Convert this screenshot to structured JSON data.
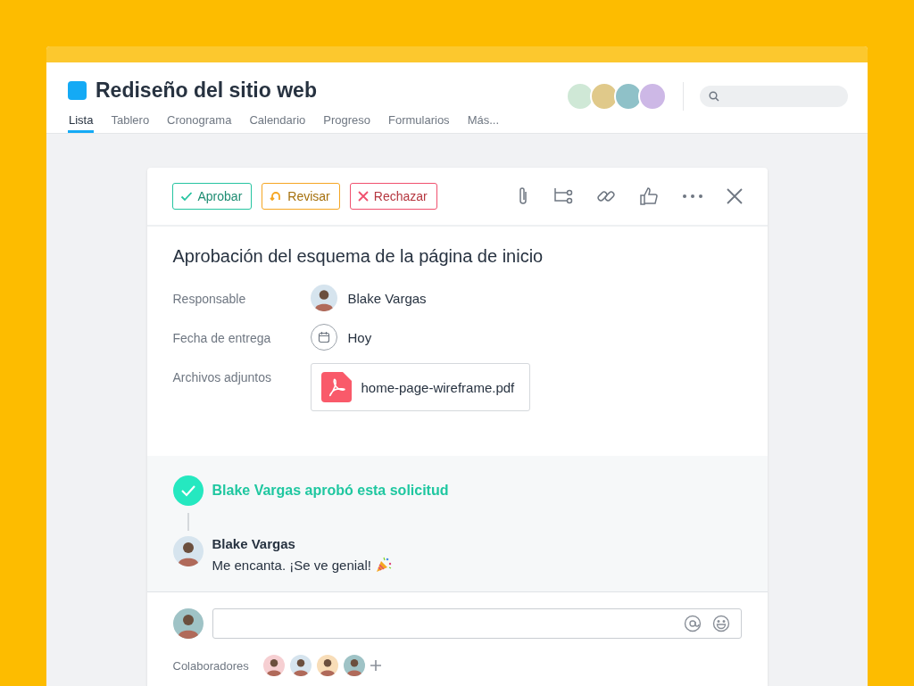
{
  "project": {
    "title": "Rediseño del sitio web"
  },
  "tabs": [
    {
      "label": "Lista",
      "selected": true
    },
    {
      "label": "Tablero",
      "selected": false
    },
    {
      "label": "Cronograma",
      "selected": false
    },
    {
      "label": "Calendario",
      "selected": false
    },
    {
      "label": "Progreso",
      "selected": false
    },
    {
      "label": "Formularios",
      "selected": false
    },
    {
      "label": "Más...",
      "selected": false
    }
  ],
  "task": {
    "actions": [
      {
        "kind": "approve",
        "label": "Aprobar"
      },
      {
        "kind": "revise",
        "label": "Revisar"
      },
      {
        "kind": "reject",
        "label": "Rechazar"
      }
    ],
    "title": "Aprobación del esquema de la página de inicio",
    "fields": [
      {
        "kind": "person",
        "label": "Responsable",
        "value": "Blake Vargas"
      },
      {
        "kind": "date",
        "label": "Fecha de entrega",
        "value": "Hoy"
      },
      {
        "kind": "file",
        "label": "Archivos adjuntos",
        "value": "home-page-wireframe.pdf"
      }
    ],
    "approval": "Blake Vargas aprobó esta solicitud",
    "comment": {
      "author": "Blake Vargas",
      "text": "Me encanta. ¡Se ve genial!"
    },
    "collaborators_label": "Colaboradores"
  }
}
